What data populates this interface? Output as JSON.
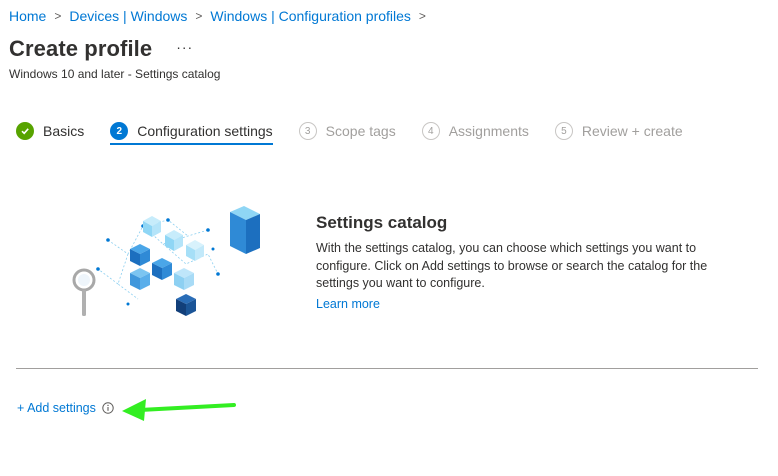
{
  "breadcrumb": {
    "items": [
      "Home",
      "Devices | Windows",
      "Windows | Configuration profiles"
    ],
    "separator": ">"
  },
  "header": {
    "title": "Create profile",
    "more_label": "···",
    "subtitle": "Windows 10 and later - Settings catalog"
  },
  "steps": [
    {
      "number": "✓",
      "label": "Basics",
      "state": "done"
    },
    {
      "number": "2",
      "label": "Configuration settings",
      "state": "active"
    },
    {
      "number": "3",
      "label": "Scope tags",
      "state": "pending"
    },
    {
      "number": "4",
      "label": "Assignments",
      "state": "pending"
    },
    {
      "number": "5",
      "label": "Review + create",
      "state": "pending"
    }
  ],
  "catalog": {
    "title": "Settings catalog",
    "description": "With the settings catalog, you can choose which settings you want to configure. Click on Add settings to browse or search the catalog for the settings you want to configure.",
    "learn_more": "Learn more"
  },
  "actions": {
    "add_settings": "+ Add settings"
  },
  "colors": {
    "link": "#0078d4",
    "success": "#57a300",
    "annotation_arrow": "#33ee22"
  },
  "icons": {
    "check": "checkmark-icon",
    "more": "ellipsis-icon",
    "info": "info-icon",
    "illustration": "settings-catalog-illustration"
  }
}
